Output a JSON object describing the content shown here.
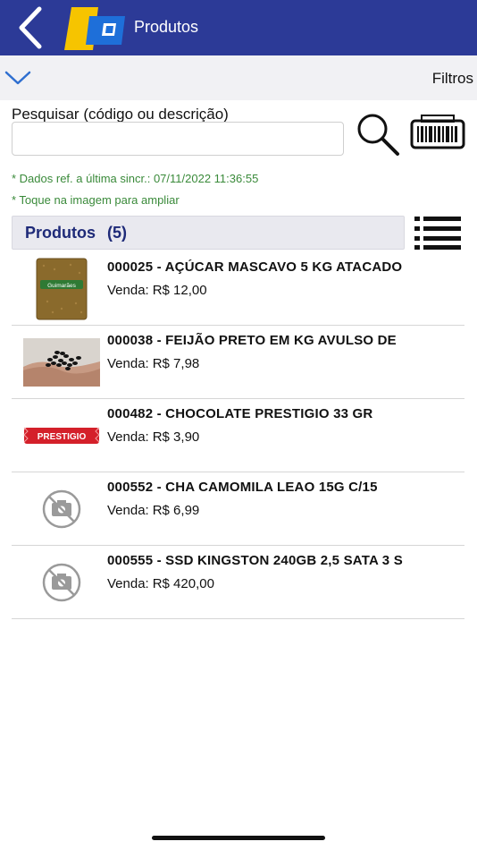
{
  "header": {
    "title": "Produtos",
    "back_icon": "chevron-left-icon",
    "logo_colors": [
      "#f6c400",
      "#1e6fd9"
    ],
    "bar_color": "#2c3a97"
  },
  "filters": {
    "label": "Filtros",
    "toggle_icon": "chevron-down-icon"
  },
  "search": {
    "label": "Pesquisar (código ou descrição)",
    "value": "",
    "placeholder": "",
    "search_icon": "magnifier-icon",
    "barcode_icon": "barcode-icon"
  },
  "notes": {
    "sync": "* Dados ref. a última sincr.: 07/11/2022 11:36:55",
    "tap": "* Toque na imagem para ampliar"
  },
  "section": {
    "title": "Produtos",
    "count": "(5)",
    "list_icon": "list-view-icon"
  },
  "products": [
    {
      "name": "000025 - AÇÚCAR MASCAVO 5 KG ATACADO",
      "price_label": "Venda:",
      "price": "R$ 12,00",
      "image": "sugar-bag-image"
    },
    {
      "name": "000038 - FEIJÃO PRETO EM KG AVULSO DE",
      "price_label": "Venda:",
      "price": "R$ 7,98",
      "image": "black-beans-image"
    },
    {
      "name": "000482 - CHOCOLATE PRESTIGIO 33 GR",
      "price_label": "Venda:",
      "price": "R$ 3,90",
      "image": "chocolate-bar-image"
    },
    {
      "name": "000552 - CHA CAMOMILA LEAO 15G C/15",
      "price_label": "Venda:",
      "price": "R$ 6,99",
      "image": "no-image-icon"
    },
    {
      "name": "000555 - SSD KINGSTON 240GB 2,5 SATA 3 S",
      "price_label": "Venda:",
      "price": "R$ 420,00",
      "image": "no-image-icon"
    }
  ],
  "chocolate_wrapper_text": "PRESTIGIO",
  "sugar_bag_text": "Guimarães"
}
